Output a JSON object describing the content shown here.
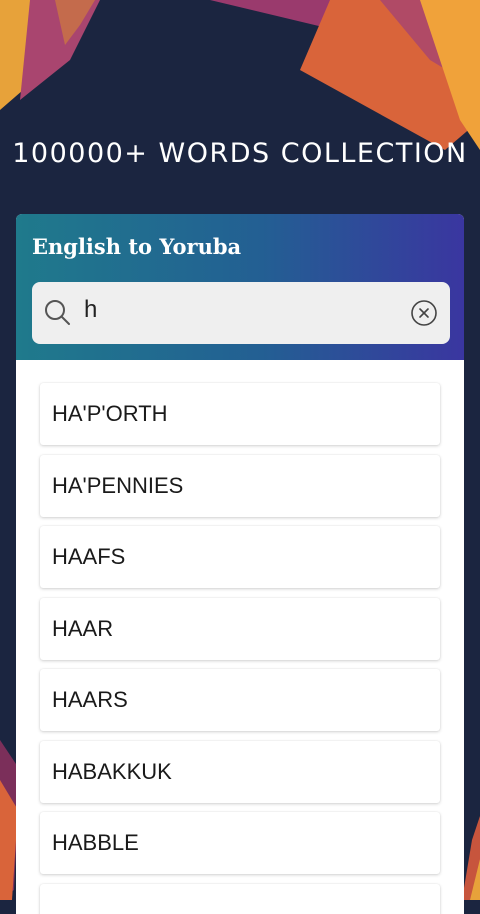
{
  "headline": "100000+ WORDS COLLECTION",
  "card": {
    "title": "English to Yoruba"
  },
  "search": {
    "value": "h",
    "search_icon": "search-icon",
    "clear_icon": "clear-circle-icon"
  },
  "results": [
    "HA'P'ORTH",
    "HA'PENNIES",
    "HAAFS",
    "HAAR",
    "HAARS",
    "HABAKKUK",
    "HABBLE",
    ""
  ],
  "colors": {
    "background": "#1b2540",
    "header_gradient_start": "#1f7a8c",
    "header_gradient_end": "#3a36a0",
    "search_field": "#efefef"
  }
}
